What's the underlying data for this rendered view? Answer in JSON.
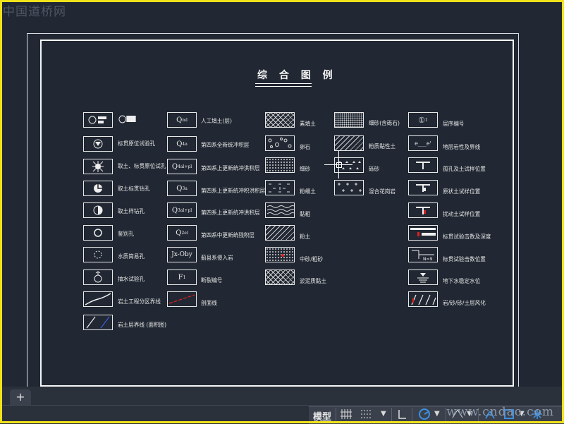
{
  "watermarks": {
    "top_left": "中国道桥网",
    "bottom_right": "www.cndao.com"
  },
  "drawing": {
    "title": "综 合 图 例",
    "col1": [
      {
        "label": ""
      },
      {
        "label": "标贯原位试验孔"
      },
      {
        "label": "取土、标贯原位试孔"
      },
      {
        "label": "取土标贯钻孔"
      },
      {
        "label": "取土样钻孔"
      },
      {
        "label": "鉴别孔"
      },
      {
        "label": "水质简易孔"
      },
      {
        "label": "抽水试验孔"
      },
      {
        "label": "岩土工程分区界线"
      },
      {
        "label": "岩土层界线 (面积图)"
      }
    ],
    "col2": [
      {
        "sym": "Q^ml",
        "label": "人工填土(层)"
      },
      {
        "sym": "Q4^a",
        "label": "第四系全新统冲积层"
      },
      {
        "sym": "Q4^al+pl",
        "label": "第四系上更新统冲洪积层"
      },
      {
        "sym": "Q3^a",
        "label": "第四系上更新统冲积洪积层"
      },
      {
        "sym": "Q3^al+pl",
        "label": "第四系上更新统冲洪积层"
      },
      {
        "sym": "Q2^el",
        "label": "第四系中更新统残积层"
      },
      {
        "sym": "Jx-Oby",
        "label": "蓟县系侵入岩"
      },
      {
        "sym": "F1",
        "label": "断裂编号"
      },
      {
        "sym": "",
        "label": "剖面线"
      }
    ],
    "col3": [
      {
        "label": "素填土"
      },
      {
        "label": "卵石"
      },
      {
        "label": "细砂"
      },
      {
        "label": "粉细土"
      },
      {
        "label": "黏粗"
      },
      {
        "label": "粉土"
      },
      {
        "label": "中砂/粗砂"
      },
      {
        "label": "淤泥质黏土"
      }
    ],
    "col4": [
      {
        "label": "细砂(含砾石)"
      },
      {
        "label": "粉质黏性土"
      },
      {
        "label": "砾砂"
      },
      {
        "label": "混合花岗岩"
      }
    ],
    "col5": [
      {
        "sym": "①1",
        "label": "层序编号"
      },
      {
        "sym": "e___e'",
        "label": "地层岩性及界线"
      },
      {
        "sym": "",
        "label": "孤孔及土试样位置"
      },
      {
        "sym": "",
        "label": "原状土试样位置"
      },
      {
        "sym": "",
        "label": "扰动土试样位置"
      },
      {
        "sym": "",
        "label": "标贯试验击数及深度"
      },
      {
        "sym": "N=9",
        "label": "标贯试验击数位置"
      },
      {
        "sym": "",
        "label": "地下水稳定水位"
      },
      {
        "sym": "",
        "label": "岩/砂/砂/土层风化"
      }
    ]
  },
  "layout_tabs": {
    "add": "+"
  },
  "statusbar": {
    "model": "模型"
  }
}
